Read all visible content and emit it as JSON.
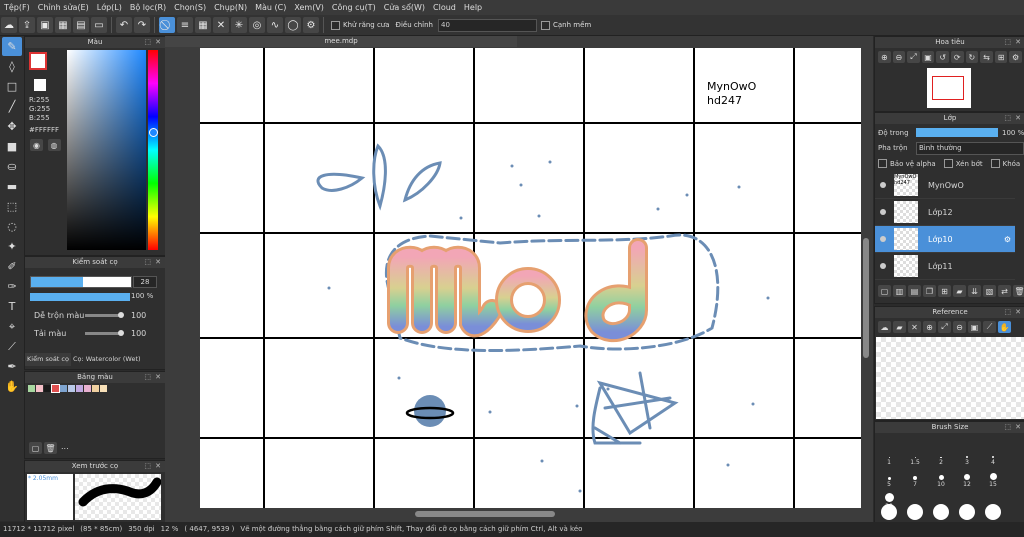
{
  "menu": [
    "Tệp(F)",
    "Chỉnh sửa(E)",
    "Lớp(L)",
    "Bộ lọc(R)",
    "Chọn(S)",
    "Chụp(N)",
    "Màu (C)",
    "Xem(V)",
    "Công cụ(T)",
    "Cửa sổ(W)",
    "Cloud",
    "Help"
  ],
  "toolbar": {
    "antialias_label": "Khử răng cưa",
    "adjust_label": "Điều chỉnh",
    "adjust_value": "40",
    "edge_label": "Cạnh mềm"
  },
  "color_panel": {
    "title": "Màu",
    "r": "R:255",
    "g": "G:255",
    "b": "B:255",
    "hex": "#FFFFFF"
  },
  "brush_control": {
    "title": "Kiểm soát cọ",
    "size_value": "28",
    "opacity_value": "100 %",
    "mix_label": "Dễ trộn màu",
    "mix_value": "100",
    "amount_label": "Tải màu",
    "amount_value": "100",
    "tab_control": "Kiểm soát cọ",
    "tab_brush": "Cọ: Watercolor (Wet)"
  },
  "palette": {
    "title": "Bảng màu",
    "colors": [
      "#a8d8a0",
      "#f5c0c8",
      "#1a1a1a",
      "#e05050",
      "#7ea4d0",
      "#b8c8e8",
      "#c0a8e0",
      "#e8b0d0",
      "#f0d0a0",
      "#f8e0b8"
    ],
    "more": "..."
  },
  "preview": {
    "title": "Xem trước cọ",
    "size": "* 2.05mm"
  },
  "document": {
    "tab": "mee.mdp",
    "note1": "MynOwO",
    "note2": "hd247",
    "artwork_text": "mod"
  },
  "navigator": {
    "title": "Hoa tiêu"
  },
  "layers": {
    "title": "Lớp",
    "opacity_label": "Độ trong",
    "opacity_value": "100 %",
    "blend_label": "Pha trộn",
    "blend_value": "Bình thường",
    "protect_alpha": "Bảo vệ alpha",
    "clipping": "Xén bớt",
    "lock": "Khóa",
    "items": [
      {
        "name": "MynOwO",
        "thumb": "MynOwO hd247",
        "selected": false
      },
      {
        "name": "Lớp12",
        "thumb": "",
        "selected": false
      },
      {
        "name": "Lớp10",
        "thumb": "",
        "selected": true
      },
      {
        "name": "Lớp11",
        "thumb": "",
        "selected": false
      }
    ]
  },
  "reference": {
    "title": "Reference"
  },
  "brush_size": {
    "title": "Brush Size",
    "sizes": [
      "1",
      "1.5",
      "2",
      "3",
      "4",
      "5",
      "7",
      "10",
      "12",
      "15",
      "20"
    ]
  },
  "status": {
    "dimensions": "11712 * 11712 pixel",
    "physical": "(85 * 85cm)",
    "dpi": "350 dpi",
    "zoom": "12 %",
    "coords": "( 4647, 9539 )",
    "hint": "Vẽ một đường thẳng bằng cách giữ phím Shift, Thay đổi cỡ cọ bằng cách giữ phím Ctrl, Alt và kéo"
  },
  "colors": {
    "accent": "#4a90d9",
    "artwork_stroke": "#6b8db5"
  }
}
